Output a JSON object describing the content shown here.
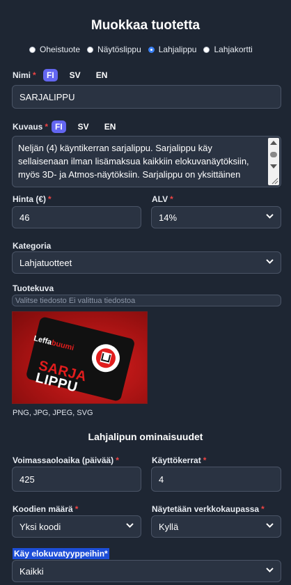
{
  "title": "Muokkaa tuotetta",
  "product_types": [
    {
      "label": "Oheistuote",
      "selected": false
    },
    {
      "label": "Näytöslippu",
      "selected": false
    },
    {
      "label": "Lahjalippu",
      "selected": true
    },
    {
      "label": "Lahjakortti",
      "selected": false
    }
  ],
  "name": {
    "label": "Nimi",
    "required": "*",
    "langs": [
      "FI",
      "SV",
      "EN"
    ],
    "active_lang": "FI",
    "value": "SARJALIPPU"
  },
  "description": {
    "label": "Kuvaus",
    "required": "*",
    "langs": [
      "FI",
      "SV",
      "EN"
    ],
    "active_lang": "FI",
    "value": "Neljän (4) käyntikerran sarjalippu. Sarjalippu käy sellaisenaan ilman lisämaksua kaikkiin elokuvanäytöksiin, myös 3D- ja Atmos-näytöksiin. Sarjalippu on yksittäinen"
  },
  "price": {
    "label": "Hinta (€)",
    "required": "*",
    "value": "46"
  },
  "vat": {
    "label": "ALV",
    "required": "*",
    "value": "14%"
  },
  "category": {
    "label": "Kategoria",
    "value": "Lahjatuotteet"
  },
  "image": {
    "label": "Tuotekuva",
    "file_text": "Valitse tiedosto Ei valittua tiedostoa",
    "brand_a": "Leffa",
    "brand_b": "buumi",
    "card_line1": "SARJA",
    "card_line2": "LIPPU",
    "formats": "PNG, JPG, JPEG, SVG"
  },
  "giftcard_section_title": "Lahjalipun ominaisuudet",
  "validity": {
    "label": "Voimassaoloaika (päivää)",
    "required": "*",
    "value": "425"
  },
  "uses": {
    "label": "Käyttökerrat",
    "required": "*",
    "value": "4"
  },
  "code_count": {
    "label": "Koodien määrä",
    "required": "*",
    "value": "Yksi koodi"
  },
  "show_in_shop": {
    "label": "Näytetään verkkokaupassa",
    "required": "*",
    "value": "Kyllä"
  },
  "movie_types": {
    "label": "Käy elokuvatyyppeihin*",
    "value": "Kaikki"
  },
  "colors": {
    "background": "#1e2633",
    "input_bg": "#2a3342",
    "accent": "#6366f1",
    "radio_selected": "#3b82f6",
    "required": "#ef4444",
    "highlight": "#1d4ed8"
  }
}
